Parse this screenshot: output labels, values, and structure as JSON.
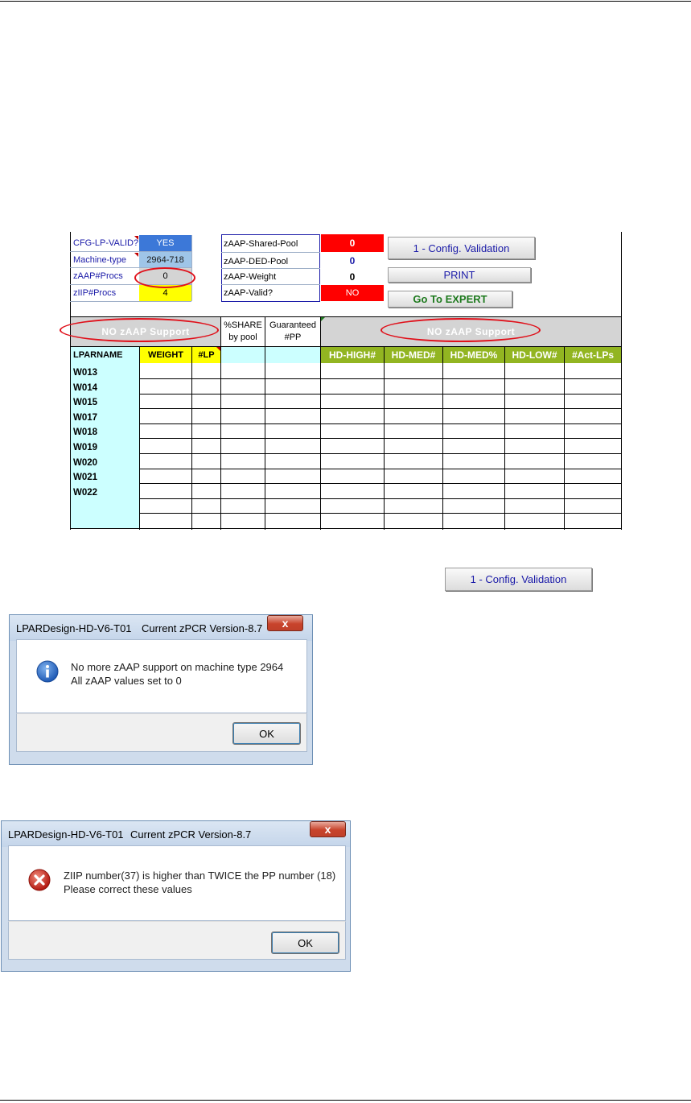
{
  "sheet": {
    "cfg_lp_valid_label": "CFG-LP-VALID?",
    "cfg_lp_valid_value": "YES",
    "machine_type_label": "Machine-type",
    "machine_type_value": "2964-718",
    "zaap_procs_label": "zAAP#Procs",
    "zaap_procs_value": "0",
    "ziip_procs_label": "zIIP#Procs",
    "ziip_procs_value": "4",
    "zaap_shared_pool_label": "zAAP-Shared-Pool",
    "zaap_shared_pool_value": "0",
    "zaap_ded_pool_label": "zAAP-DED-Pool",
    "zaap_ded_pool_value": "0",
    "zaap_weight_label": "zAAP-Weight",
    "zaap_weight_value": "0",
    "zaap_valid_label": "zAAP-Valid?",
    "zaap_valid_value": "NO",
    "buttons": {
      "config_validation": "1 - Config. Validation",
      "print": "PRINT",
      "go_to_expert": "Go To EXPERT"
    },
    "no_zaap_left": "NO zAAP Support",
    "no_zaap_right": "NO zAAP Support",
    "share_header_1": "%SHARE",
    "share_header_2": "by pool",
    "guaranteed_header_1": "Guaranteed",
    "guaranteed_header_2": "#PP",
    "columns": [
      "LPARNAME",
      "WEIGHT",
      "#LP",
      "HD-HIGH#",
      "HD-MED#",
      "HD-MED%",
      "HD-LOW#",
      "#Act-LPs"
    ],
    "rows": [
      "W013",
      "W014",
      "W015",
      "W017",
      "W018",
      "W019",
      "W020",
      "W021",
      "W022",
      "",
      ""
    ]
  },
  "standalone_button": "1 - Config. Validation",
  "dialog1": {
    "title": "LPARDesign-HD-V6-T01",
    "subtitle": "Current zPCR Version-8.7",
    "close": "x",
    "line1": "No more zAAP support on machine type 2964",
    "line2": "All zAAP values set to 0",
    "ok": "OK",
    "icon": "info-icon"
  },
  "dialog2": {
    "title": "LPARDesign-HD-V6-T01",
    "subtitle": "Current zPCR Version-8.7",
    "close": "x",
    "line1": "ZIIP number(37) is higher than TWICE the PP number (18)",
    "line2": "Please correct these values",
    "ok": "OK",
    "icon": "error-icon"
  },
  "colors": {
    "light_cyan": "#ccffff",
    "olive_green": "#92b521",
    "yellow": "#ffff00",
    "red": "#ff0000",
    "blue": "#3c78d8",
    "grey": "#d4d4d4",
    "oval_red": "#e0101a"
  }
}
